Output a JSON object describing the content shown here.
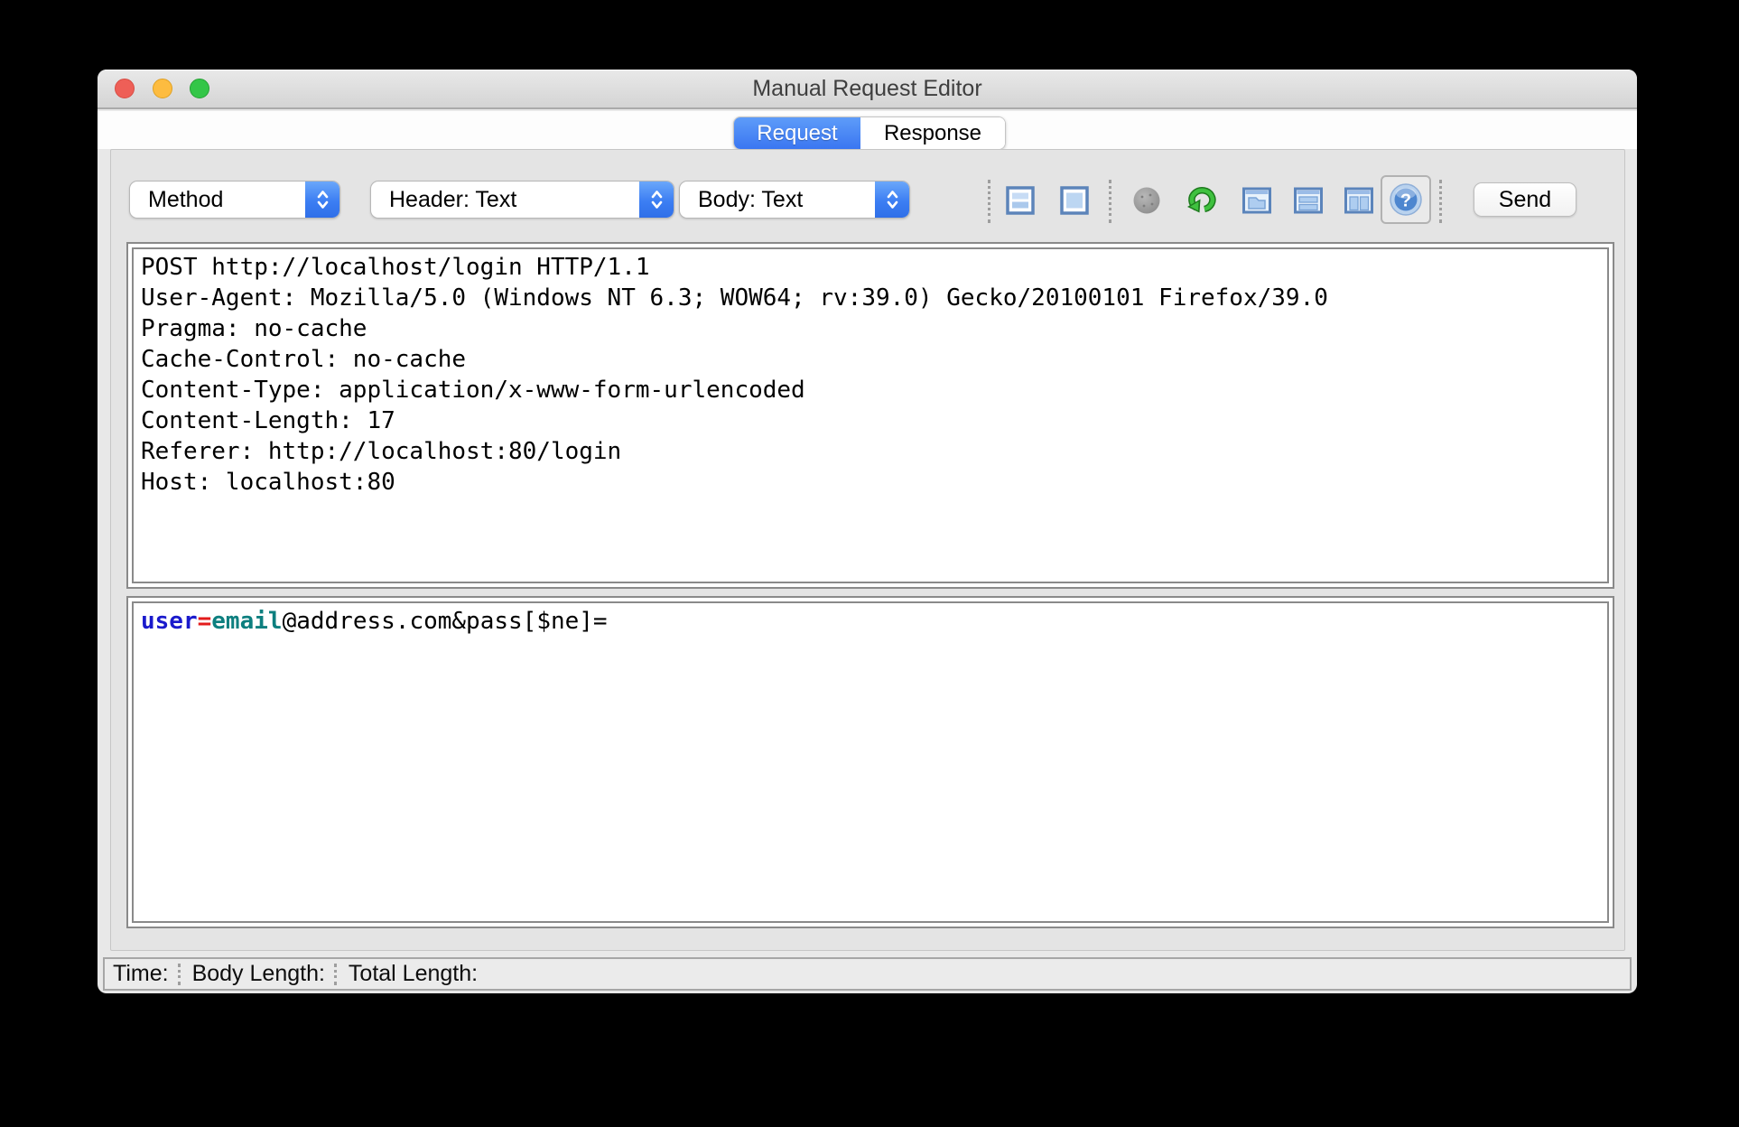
{
  "window": {
    "title": "Manual Request Editor"
  },
  "tabs": {
    "request": "Request",
    "response": "Response"
  },
  "toolbar": {
    "method_dropdown": "Method",
    "header_dropdown": "Header: Text",
    "body_dropdown": "Body: Text",
    "send_button": "Send",
    "icons": [
      "combined-view-icon",
      "single-view-icon",
      "record-disabled-icon",
      "follow-redirects-icon",
      "tab-view-icon",
      "horizontal-split-view-icon",
      "vertical-split-view-icon",
      "help-icon"
    ]
  },
  "request": {
    "header_lines": [
      "POST http://localhost/login HTTP/1.1",
      "User-Agent: Mozilla/5.0 (Windows NT 6.3; WOW64; rv:39.0) Gecko/20100101 Firefox/39.0",
      "Pragma: no-cache",
      "Cache-Control: no-cache",
      "Content-Type: application/x-www-form-urlencoded",
      "Content-Length: 17",
      "Referer: http://localhost:80/login",
      "Host: localhost:80"
    ],
    "body_segments": [
      {
        "text": "user",
        "color": "#1a1acc"
      },
      {
        "text": "=",
        "color": "#e31b1b"
      },
      {
        "text": "email",
        "color": "#0d7f7f"
      },
      {
        "text": "@address.com&pass[$ne]=",
        "color": "#000000"
      }
    ]
  },
  "status_bar": {
    "time_label": "Time:",
    "body_length_label": "Body Length:",
    "total_length_label": "Total Length:"
  },
  "colors": {
    "selected_tab_blue": "#3f7ef4",
    "dropdown_cap_blue": "#3c7ef3",
    "icon_border_blue": "#5c84ba",
    "icon_fill_blue": "#bcd6f2",
    "redirect_green": "#2fa52f",
    "panel_gray": "#e4e4e4"
  }
}
